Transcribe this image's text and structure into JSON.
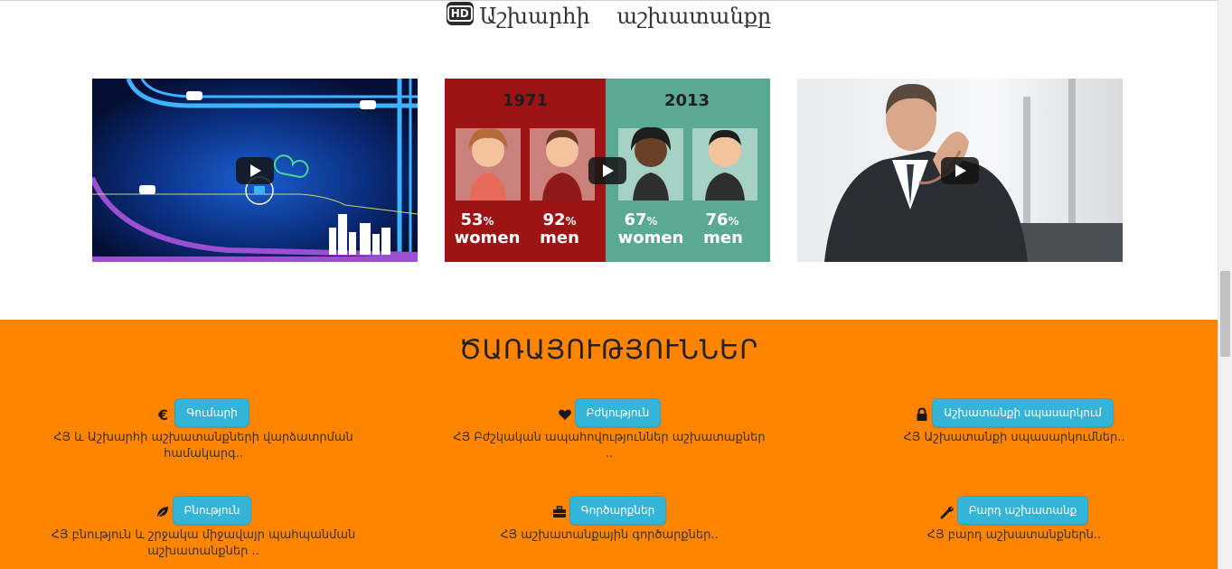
{
  "video_section": {
    "hd_label": "HD",
    "title": "Աշխարհի աշխատանքը",
    "videos": [
      {
        "name": "city-roads-animation"
      },
      {
        "name": "employment-stats-infographic",
        "year_left": "1971",
        "year_right": "2013",
        "stats": [
          {
            "value": "53",
            "unit": "%",
            "label": "women"
          },
          {
            "value": "92",
            "unit": "%",
            "label": "men"
          },
          {
            "value": "67",
            "unit": "%",
            "label": "women"
          },
          {
            "value": "76",
            "unit": "%",
            "label": "men"
          }
        ]
      },
      {
        "name": "businessman-photo"
      }
    ]
  },
  "features": {
    "title": "ԾԱՌԱՅՈՒԹՅՈՒՆՆԵՐ",
    "items": [
      {
        "icon": "euro-icon",
        "button": "Գումարի",
        "desc": "ՀՅ և Աշխարհի աշխատանքների վարձատրման համակարգ.."
      },
      {
        "icon": "heart-icon",
        "button": "Բժկություն",
        "desc": "ՀՅ Բժշկական ապահովություններ աշխատաքներ .."
      },
      {
        "icon": "lock-icon",
        "button": "Աշխատանքի սպասարկում",
        "desc": "ՀՅ Աշխատանքի սպասարկումներ.."
      },
      {
        "icon": "leaf-icon",
        "button": "Բնություն",
        "desc": "ՀՅ բնություն և շրջակա միջավայր պահպանման աշխատանքներ .."
      },
      {
        "icon": "briefcase-icon",
        "button": "Գործարքներ",
        "desc": "ՀՅ աշխատանքային գործարքներ.."
      },
      {
        "icon": "wrench-icon",
        "button": "Բարդ աշխատանք",
        "desc": "ՀՅ բարդ աշխատանքներն.."
      }
    ]
  },
  "colors": {
    "features_bg": "#ff8400",
    "button_bg": "#34b5d8",
    "infographic_left_bg": "#9e1414",
    "infographic_right_bg": "#5aa992"
  }
}
